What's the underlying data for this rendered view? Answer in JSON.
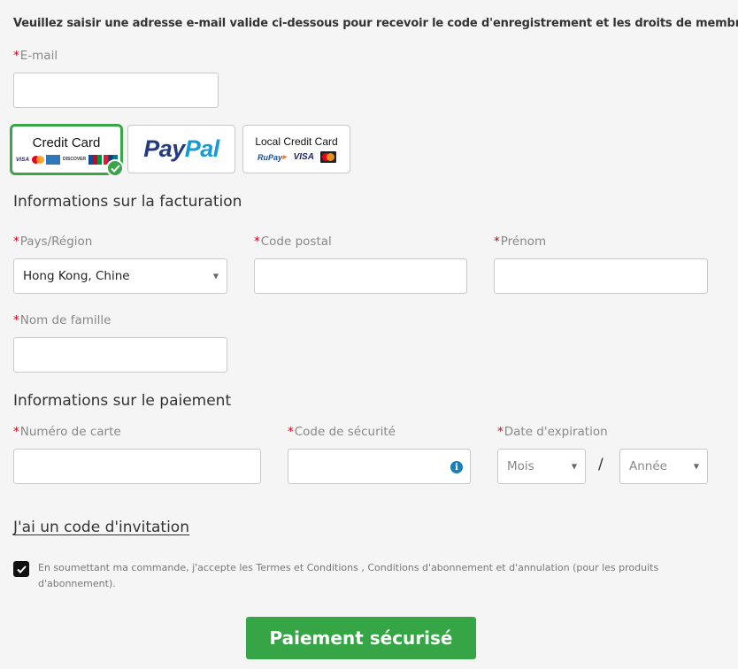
{
  "intro_text": "Veuillez saisir une adresse e-mail valide ci-dessous pour recevoir le code d'enregistrement et les droits de membre.",
  "required_mark": "*",
  "email": {
    "label": "E-mail",
    "value": ""
  },
  "payment_methods": {
    "credit_card": {
      "title": "Credit Card",
      "logos": [
        "VISA",
        "mastercard",
        "AMEX",
        "DISCOVER",
        "JCB",
        "UnionPay"
      ],
      "selected": true
    },
    "paypal": {
      "title_part1": "Pay",
      "title_part2": "Pal"
    },
    "local_credit_card": {
      "title": "Local Credit Card",
      "logos": [
        "RuPay",
        "VISA",
        "MasterCard"
      ]
    }
  },
  "billing": {
    "title": "Informations sur la facturation",
    "country": {
      "label": "Pays/Région",
      "value": "Hong Kong, Chine"
    },
    "postal_code": {
      "label": "Code postal",
      "value": ""
    },
    "first_name": {
      "label": "Prénom",
      "value": ""
    },
    "last_name": {
      "label": "Nom de famille",
      "value": ""
    }
  },
  "payment": {
    "title": "Informations sur le paiement",
    "card_number": {
      "label": "Numéro de carte",
      "value": ""
    },
    "security_code": {
      "label": "Code de sécurité",
      "value": ""
    },
    "expiration": {
      "label": "Date d'expiration",
      "month": "Mois",
      "separator": "/",
      "year": "Année"
    }
  },
  "invite_link": "J'ai un code d'invitation",
  "terms": {
    "checked": true,
    "text": "En soumettant ma commande, j'accepte les Termes et Conditions , Conditions d'abonnement et d'annulation (pour les produits d'abonnement)."
  },
  "submit_button": "Paiement sécurisé",
  "colors": {
    "accent_green": "#35a545",
    "required_red": "#d0021b",
    "info_blue": "#1b7fb8"
  }
}
